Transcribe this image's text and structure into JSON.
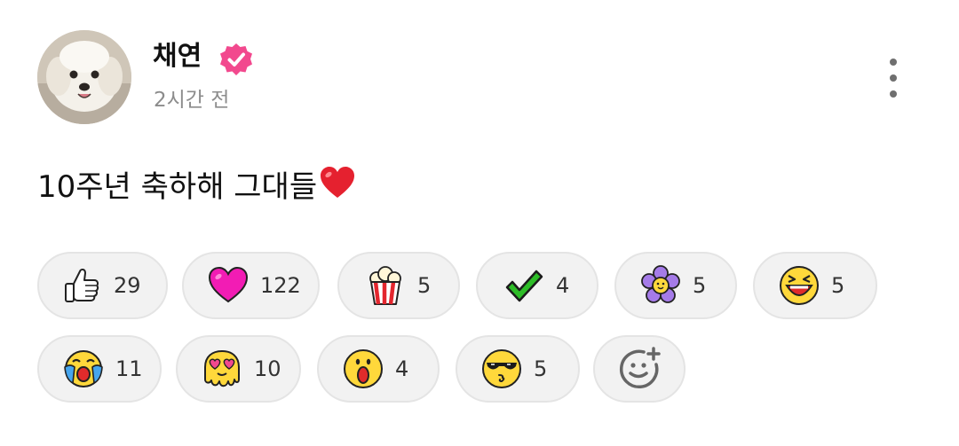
{
  "post": {
    "author": {
      "name": "채연",
      "verified": true,
      "avatar": "dog-photo"
    },
    "timestamp": "2시간 전",
    "text": "10주년 축하해 그대들",
    "text_emoji": "red-heart",
    "menu_icon": "more-vertical-icon"
  },
  "reactions": [
    {
      "icon": "thumbs-up-icon",
      "count": "29"
    },
    {
      "icon": "pink-heart-icon",
      "count": "122"
    },
    {
      "icon": "popcorn-icon",
      "count": "5"
    },
    {
      "icon": "green-check-icon",
      "count": "4"
    },
    {
      "icon": "purple-flower-icon",
      "count": "5"
    },
    {
      "icon": "laughing-face-icon",
      "count": "5"
    },
    {
      "icon": "crying-laughing-face-icon",
      "count": "11"
    },
    {
      "icon": "heart-eyes-melting-face-icon",
      "count": "10"
    },
    {
      "icon": "surprised-face-icon",
      "count": "4"
    },
    {
      "icon": "sunglasses-kiss-face-icon",
      "count": "5"
    }
  ],
  "add_reaction_icon": "add-emoji-icon",
  "colors": {
    "verified_badge": "#f2498e",
    "pill_background": "#f2f2f2",
    "timestamp_text": "#8c8c8c"
  }
}
